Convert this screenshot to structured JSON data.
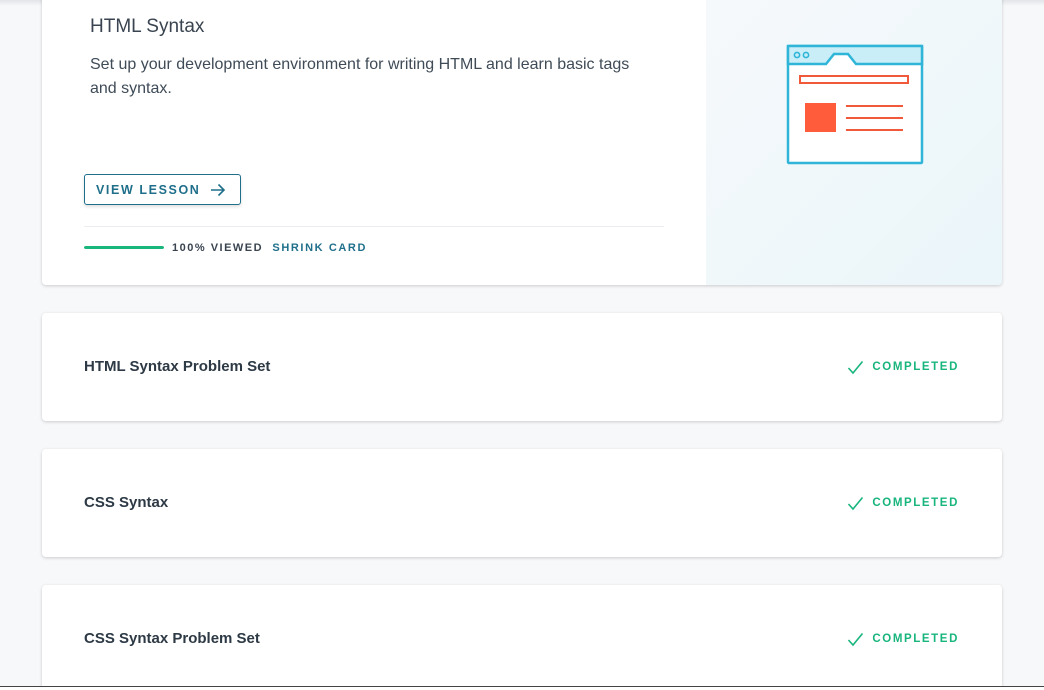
{
  "lesson": {
    "title": "HTML Syntax",
    "description": "Set up your development environment for writing HTML and learn basic tags and syntax.",
    "view_button": "VIEW LESSON",
    "progress_label": "100% VIEWED",
    "progress_fraction": 1.0,
    "shrink_label": "SHRINK CARD"
  },
  "items": [
    {
      "title": "HTML Syntax Problem Set",
      "status": "COMPLETED"
    },
    {
      "title": "CSS Syntax",
      "status": "COMPLETED"
    },
    {
      "title": "CSS Syntax Problem Set",
      "status": "COMPLETED"
    }
  ],
  "icons": {
    "browser": "browser-window-illustration",
    "arrow": "arrow-right-icon",
    "check": "check-icon"
  },
  "colors": {
    "accent": "#1f6f8b",
    "success": "#18b57d",
    "illustration_blue": "#2fb5d8",
    "illustration_orange": "#f05a3a"
  }
}
